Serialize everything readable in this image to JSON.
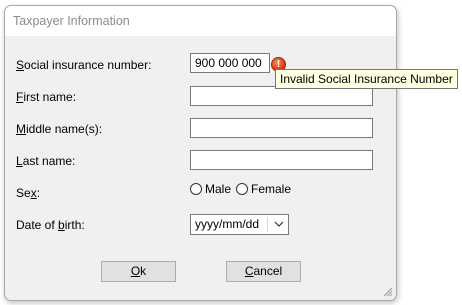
{
  "dialog": {
    "title": "Taxpayer Information"
  },
  "fields": {
    "sin": {
      "label_pre": "",
      "label_u": "S",
      "label_post": "ocial insurance number:",
      "value": "900 000 000"
    },
    "first_name": {
      "label_pre": "",
      "label_u": "F",
      "label_post": "irst name:",
      "value": ""
    },
    "middle_name": {
      "label_pre": "",
      "label_u": "M",
      "label_post": "iddle name(s):",
      "value": ""
    },
    "last_name": {
      "label_pre": "",
      "label_u": "L",
      "label_post": "ast name:",
      "value": ""
    },
    "sex": {
      "label_pre": "Se",
      "label_u": "x",
      "label_post": ":",
      "options": [
        "Male",
        "Female"
      ]
    },
    "dob": {
      "label_pre": "Date of ",
      "label_u": "b",
      "label_post": "irth:",
      "value": "yyyy/mm/dd"
    }
  },
  "error": {
    "tooltip": "Invalid Social Insurance Number",
    "icon": "error-icon",
    "color": "#d3320b"
  },
  "buttons": {
    "ok": {
      "pre": "",
      "u": "O",
      "post": "k"
    },
    "cancel": {
      "pre": "",
      "u": "C",
      "post": "ancel"
    }
  }
}
